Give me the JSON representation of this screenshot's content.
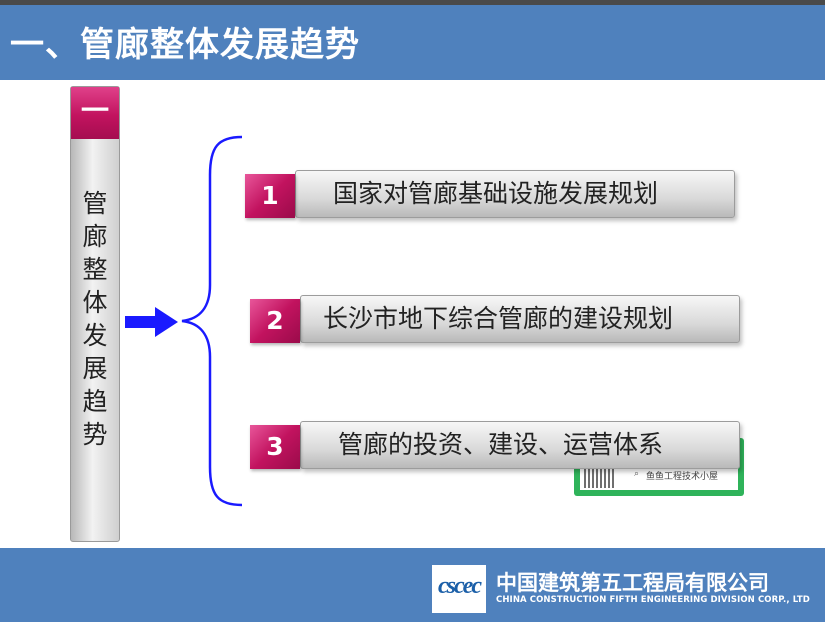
{
  "header": {
    "title": "一、管廊整体发展趋势"
  },
  "side_bar": {
    "cap": "一",
    "vertical_text": [
      "管",
      "廊",
      "整",
      "体",
      "发",
      "展",
      "趋",
      "势"
    ]
  },
  "items": [
    {
      "number": "1",
      "label": "国家对管廊基础设施发展规划"
    },
    {
      "number": "2",
      "label": "长沙市地下综合管廊的建设规划"
    },
    {
      "number": "3",
      "label": "管廊的投资、建设、运营体系"
    }
  ],
  "watermark": {
    "search_text": "鱼鱼工程技术小屋"
  },
  "footer": {
    "logo_text": "cscec",
    "company_cn": "中国建筑第五工程局有限公司",
    "company_en": "CHINA CONSTRUCTION FIFTH ENGINEERING DIVISION CORP., LTD"
  },
  "colors": {
    "header_bg": "#4f81bd",
    "accent_magenta": "#c2135f",
    "arrow_blue": "#1a1aff",
    "brace_blue": "#1a1aff"
  }
}
